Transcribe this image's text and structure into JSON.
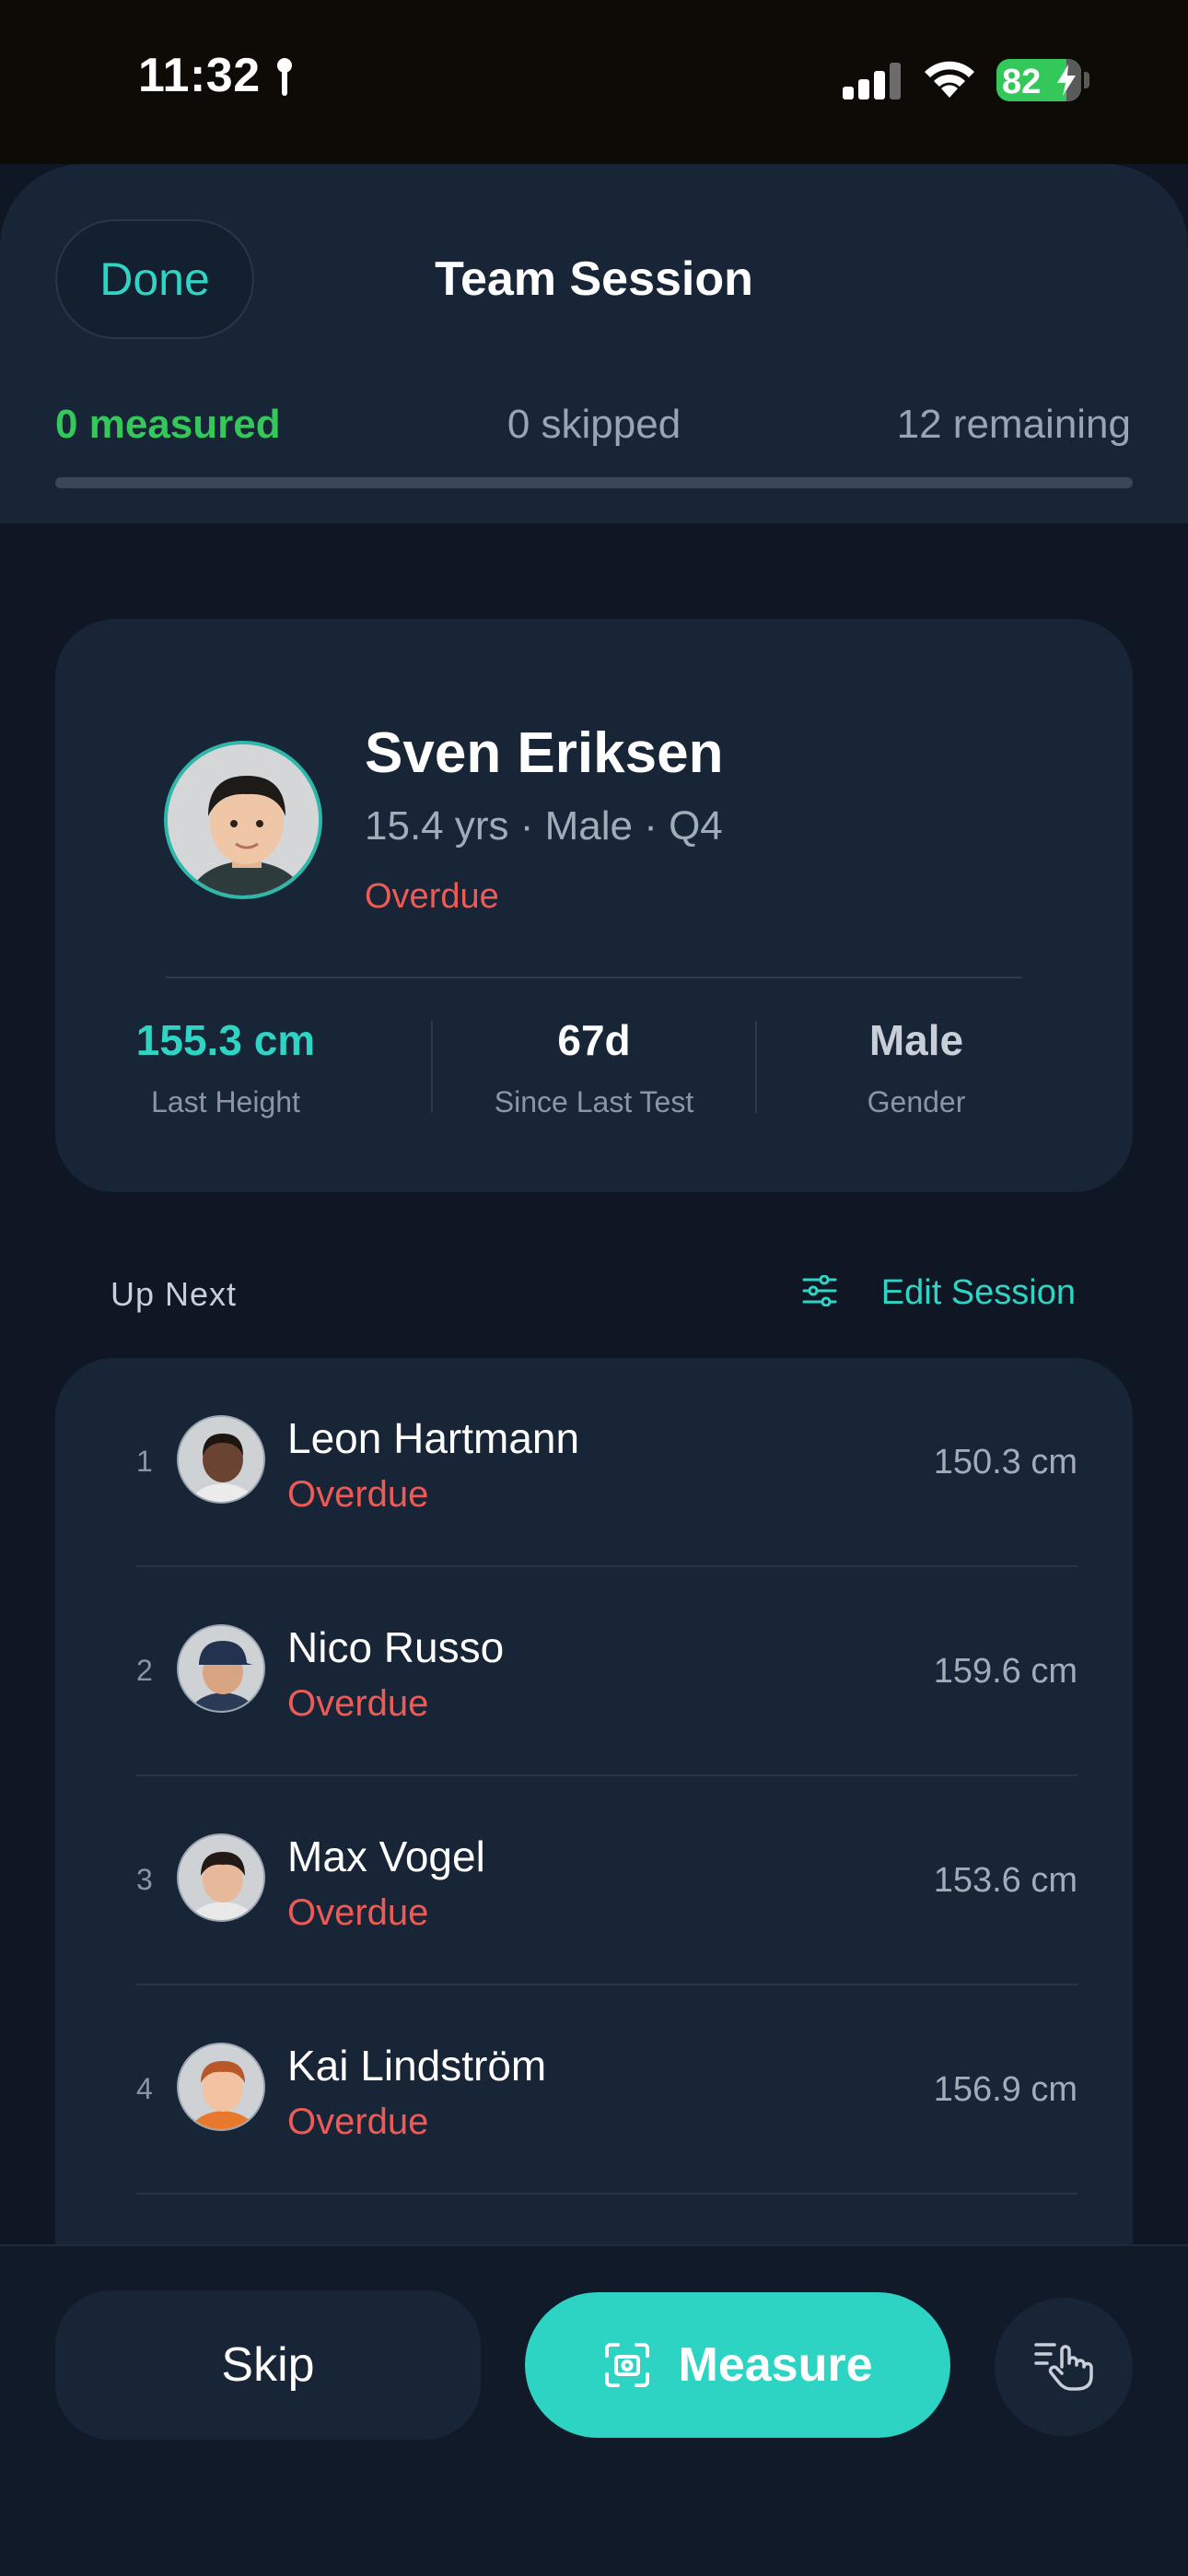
{
  "status_bar": {
    "time": "11:32",
    "battery": "82"
  },
  "header": {
    "done_label": "Done",
    "title": "Team Session",
    "measured": "0 measured",
    "skipped": "0 skipped",
    "remaining": "12 remaining",
    "progress": 0
  },
  "current": {
    "name": "Sven Eriksen",
    "meta": "15.4 yrs · Male · Q4",
    "status": "Overdue",
    "metrics": [
      {
        "value": "155.3 cm",
        "label": "Last Height",
        "color": "#2fd4c4"
      },
      {
        "value": "67d",
        "label": "Since Last Test",
        "color": "#ffffff"
      },
      {
        "value": "Male",
        "label": "Gender",
        "color": "#c9cfd8"
      }
    ]
  },
  "up_next": {
    "label": "Up Next",
    "edit_label": "Edit Session",
    "items": [
      {
        "num": "1",
        "name": "Leon Hartmann",
        "status": "Overdue",
        "height": "150.3 cm"
      },
      {
        "num": "2",
        "name": "Nico Russo",
        "status": "Overdue",
        "height": "159.6 cm"
      },
      {
        "num": "3",
        "name": "Max Vogel",
        "status": "Overdue",
        "height": "153.6 cm"
      },
      {
        "num": "4",
        "name": "Kai Lindström",
        "status": "Overdue",
        "height": "156.9 cm"
      }
    ]
  },
  "actions": {
    "skip_label": "Skip",
    "measure_label": "Measure"
  },
  "colors": {
    "accent": "#2dd4c4",
    "success": "#34c759",
    "danger": "#ee5a55",
    "background": "#0f1724",
    "card": "#172537"
  }
}
